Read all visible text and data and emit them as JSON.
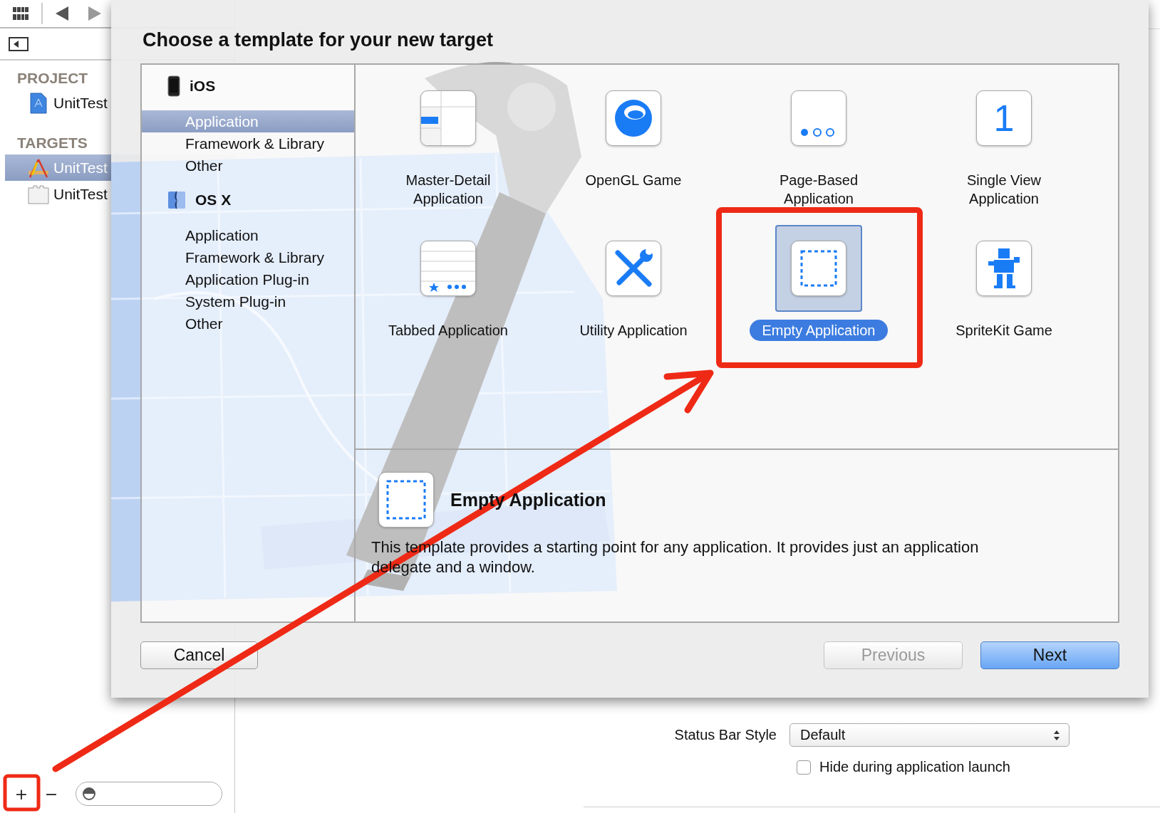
{
  "sidebar": {
    "sections": [
      {
        "title": "PROJECT",
        "items": [
          {
            "label": "UnitTest",
            "selected": false
          }
        ]
      },
      {
        "title": "TARGETS",
        "items": [
          {
            "label": "UnitTest",
            "selected": true
          },
          {
            "label": "UnitTest",
            "selected": false
          }
        ]
      }
    ],
    "bottom_bar": {
      "add": "+",
      "remove": "−"
    }
  },
  "settings": {
    "status_bar_style": {
      "label": "Status Bar Style",
      "value": "Default"
    },
    "hide_option": {
      "label": "Hide during application launch",
      "checked": false
    }
  },
  "dialog": {
    "title": "Choose a template for your new target",
    "categories": [
      {
        "platform": "iOS",
        "items": [
          {
            "label": "Application",
            "selected": true
          },
          {
            "label": "Framework & Library",
            "selected": false
          },
          {
            "label": "Other",
            "selected": false
          }
        ]
      },
      {
        "platform": "OS X",
        "items": [
          {
            "label": "Application",
            "selected": false
          },
          {
            "label": "Framework & Library",
            "selected": false
          },
          {
            "label": "Application Plug-in",
            "selected": false
          },
          {
            "label": "System Plug-in",
            "selected": false
          },
          {
            "label": "Other",
            "selected": false
          }
        ]
      }
    ],
    "templates": [
      {
        "label": "Master-Detail Application",
        "selected": false
      },
      {
        "label": "OpenGL Game",
        "selected": false
      },
      {
        "label": "Page-Based Application",
        "selected": false
      },
      {
        "label": "Single View Application",
        "glyph": "1",
        "selected": false
      },
      {
        "label": "Tabbed Application",
        "selected": false
      },
      {
        "label": "Utility Application",
        "selected": false
      },
      {
        "label": "Empty Application",
        "selected": true
      },
      {
        "label": "SpriteKit Game",
        "selected": false
      }
    ],
    "description": {
      "title": "Empty Application",
      "text": "This template provides a starting point for any application. It provides just an application delegate and a window."
    },
    "buttons": [
      {
        "label": "Cancel",
        "kind": "normal",
        "disabled": false
      },
      {
        "label": "Previous",
        "kind": "normal",
        "disabled": true
      },
      {
        "label": "Next",
        "kind": "default",
        "disabled": false
      }
    ]
  }
}
